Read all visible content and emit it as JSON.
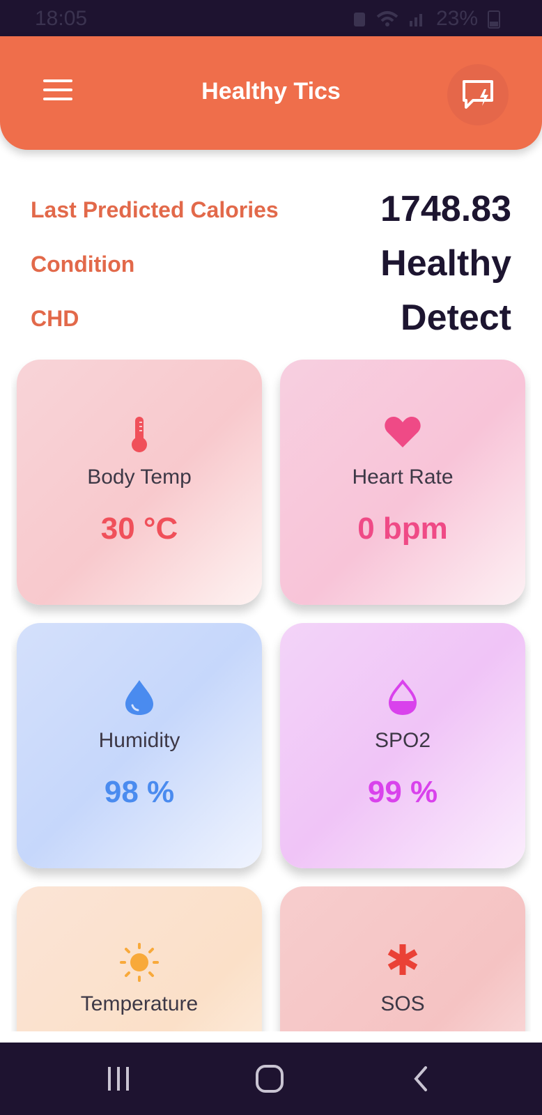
{
  "status_bar": {
    "time": "18:05",
    "battery": "23%"
  },
  "app_bar": {
    "title": "Healthy Tics"
  },
  "summary": [
    {
      "label": "Last Predicted Calories",
      "value": "1748.83"
    },
    {
      "label": "Condition",
      "value": "Healthy"
    },
    {
      "label": "CHD",
      "value": "Detect"
    }
  ],
  "cards": [
    {
      "label": "Body Temp",
      "value": "30 °C",
      "icon": "thermometer-icon",
      "color": "#f0505a"
    },
    {
      "label": "Heart Rate",
      "value": "0 bpm",
      "icon": "heart-icon",
      "color": "#ef4a86"
    },
    {
      "label": "Humidity",
      "value": "98 %",
      "icon": "water-drop-icon",
      "color": "#4a8bef"
    },
    {
      "label": "SPO2",
      "value": "99 %",
      "icon": "oxygen-drop-icon",
      "color": "#d942ec"
    },
    {
      "label": "Temperature",
      "value": "",
      "icon": "sun-icon",
      "color": "#f8a93a"
    },
    {
      "label": "SOS",
      "value": "",
      "icon": "asterisk-icon",
      "color": "#ea4136"
    }
  ]
}
